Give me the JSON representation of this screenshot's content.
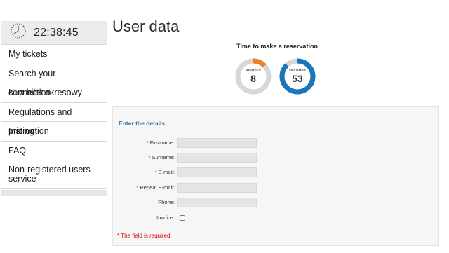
{
  "clock": {
    "icon": "clock-icon",
    "time": "22:38:45"
  },
  "sidebar": {
    "items": [
      {
        "label": "My tickets"
      },
      {
        "label": "Search your connection"
      },
      {
        "label": "Kup bilet okresowy"
      },
      {
        "label": "Regulations and pricing"
      },
      {
        "label": "Instruction"
      },
      {
        "label": "FAQ"
      },
      {
        "label": "Non-registered users service"
      }
    ]
  },
  "page": {
    "title": "User data"
  },
  "timer": {
    "title": "Time to make a reservation",
    "minutes": {
      "label": "MINUTES",
      "value": "8",
      "fraction": 0.13,
      "color": "#f0801f"
    },
    "seconds": {
      "label": "SECONDS",
      "value": "53",
      "fraction": 0.88,
      "color": "#1b75bb"
    },
    "track_color": "#d7d7d7"
  },
  "form": {
    "heading": "Enter the details:",
    "fields": {
      "firstname": {
        "label": "Firstname:",
        "required": "*",
        "value": ""
      },
      "surname": {
        "label": "Surname:",
        "required": "*",
        "value": ""
      },
      "email": {
        "label": "E-mail:",
        "required": "*",
        "value": ""
      },
      "repeat_email": {
        "label": "Repeat E-mail:",
        "required": "*",
        "value": ""
      },
      "phone": {
        "label": "Phone:",
        "value": ""
      },
      "invoice": {
        "label": "Invoice:",
        "checked": false
      }
    },
    "required_note": "* The field is required"
  }
}
